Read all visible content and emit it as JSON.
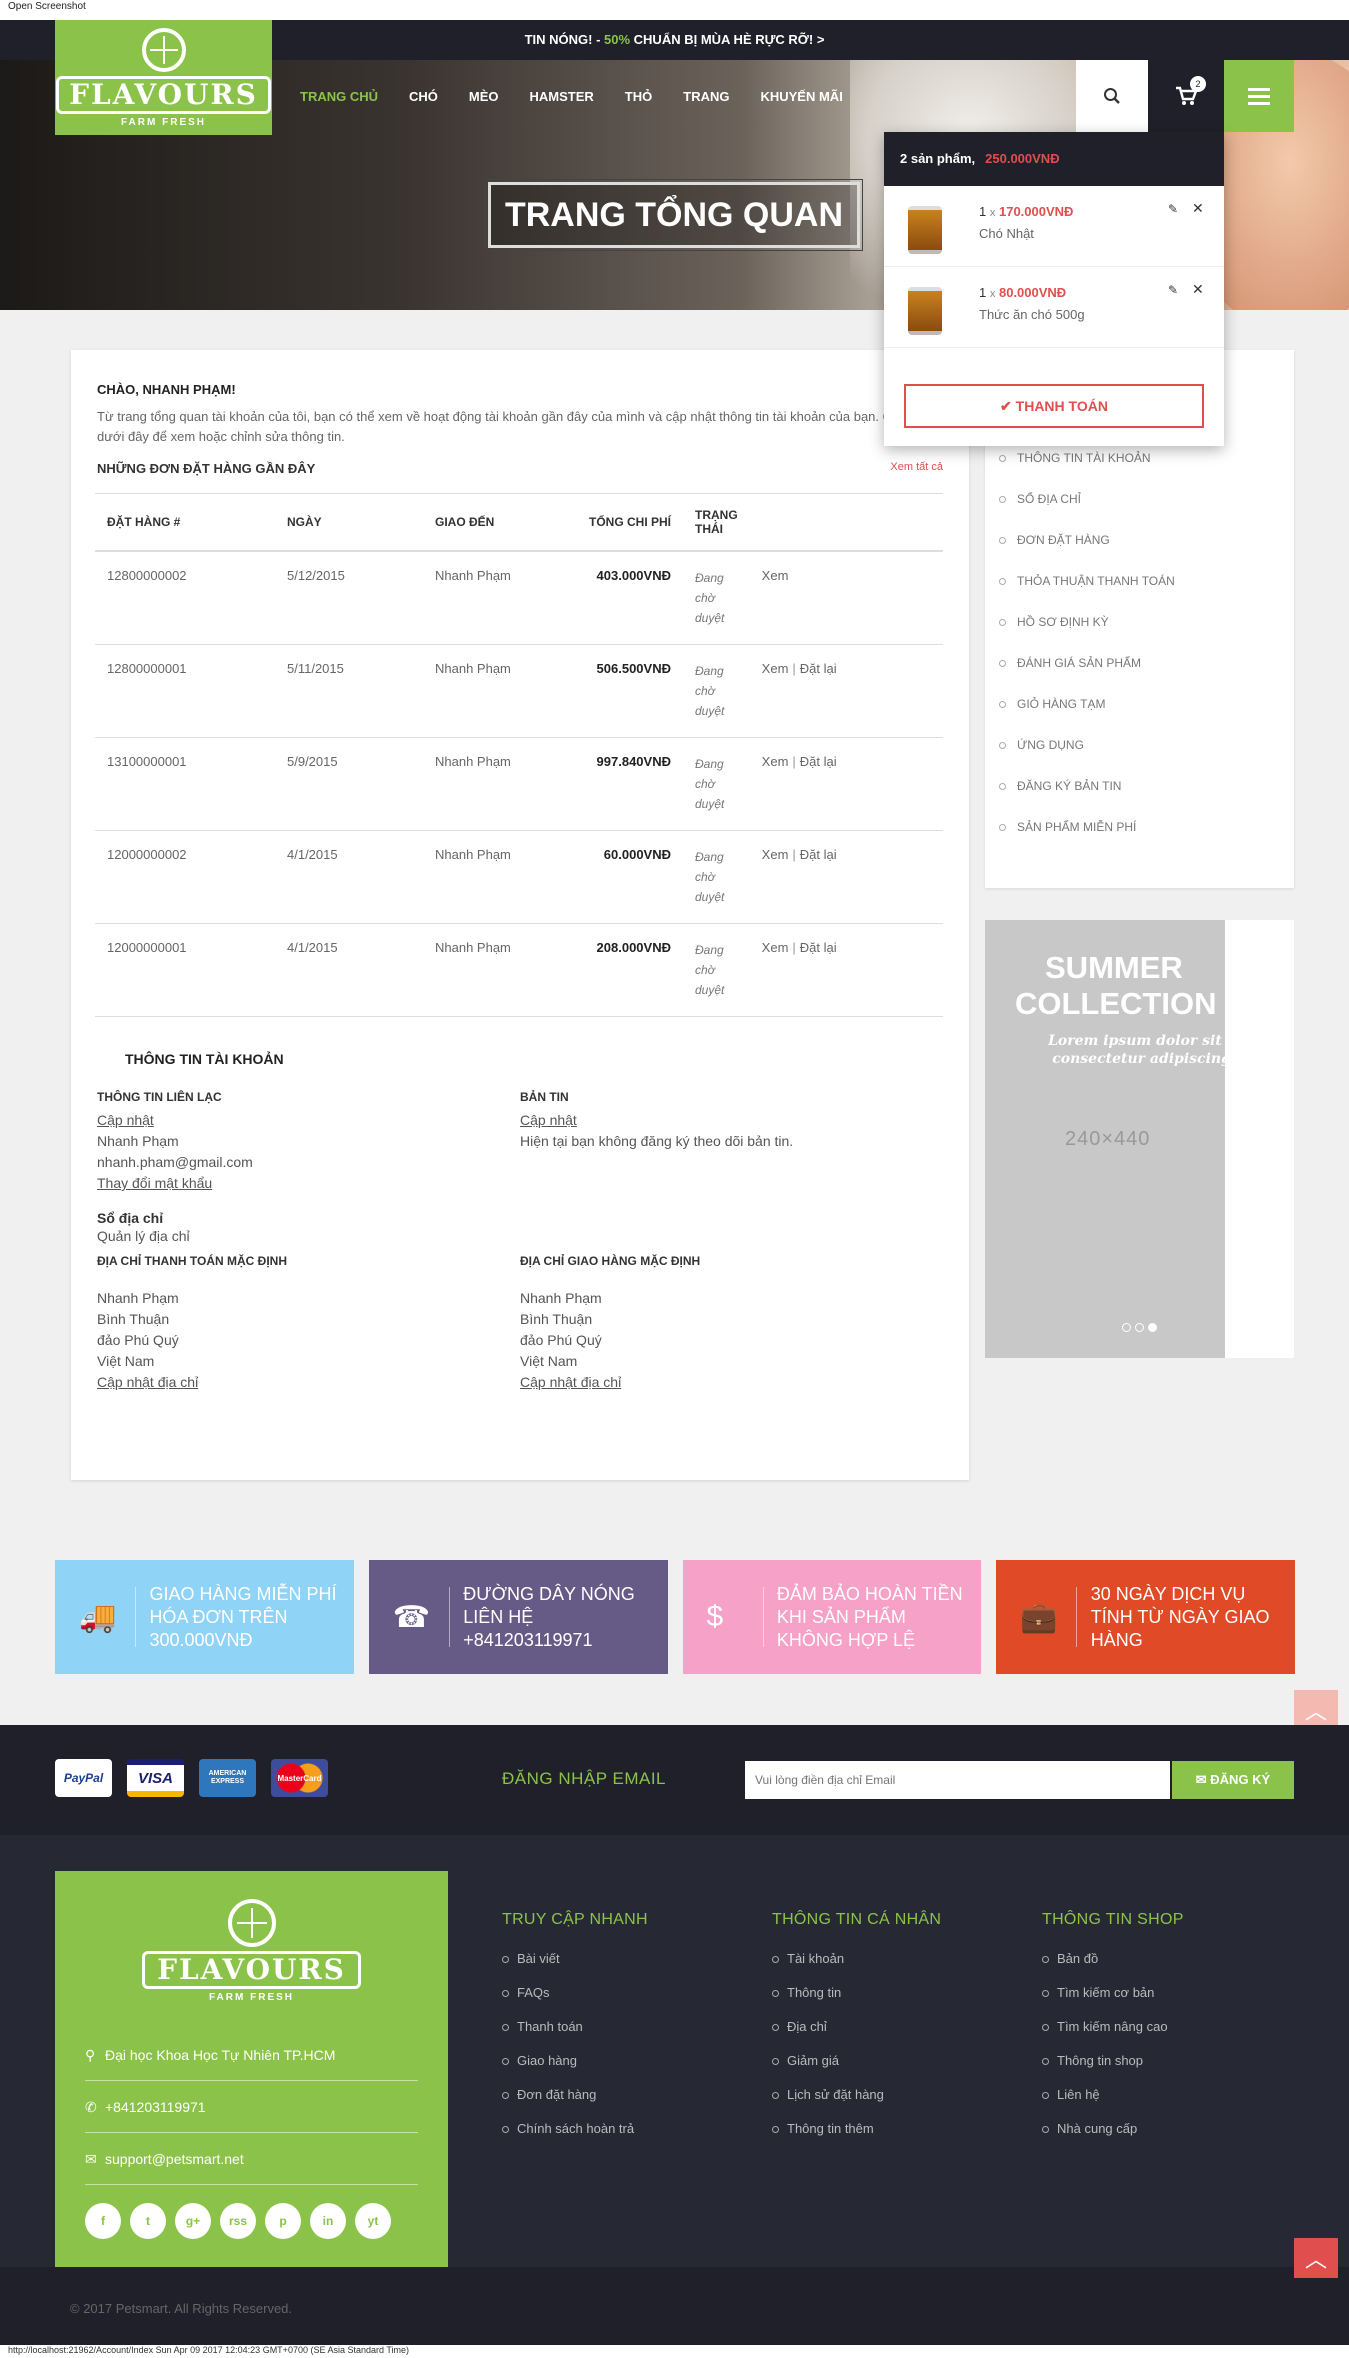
{
  "screenshot": {
    "top_label": "Open Screenshot",
    "status_url": "http://localhost:21962/Account/Index Sun Apr 09 2017 12:04:23 GMT+0700 (SE Asia Standard Time)"
  },
  "topbar": {
    "prefix": "TIN NÓNG! - ",
    "highlight": "50%",
    "suffix": " CHUẨN BỊ MÙA HÈ RỰC RỠ! >"
  },
  "logo": {
    "brand": "FLAVOURS",
    "tagline": "FARM FRESH"
  },
  "nav": {
    "items": [
      "TRANG CHỦ",
      "CHÓ",
      "MÈO",
      "HAMSTER",
      "THỎ",
      "TRANG",
      "KHUYẾN MÃI"
    ],
    "active": 0
  },
  "cart": {
    "count": "2"
  },
  "hero": {
    "title": "TRANG TỔNG QUAN"
  },
  "minicart": {
    "summary": "2 sản phẩm,",
    "total": "250.000VNĐ",
    "items": [
      {
        "qty": "1",
        "price": "170.000VNĐ",
        "name": "Chó Nhật"
      },
      {
        "qty": "1",
        "price": "80.000VNĐ",
        "name": "Thức ăn chó 500g"
      }
    ],
    "checkout": "THANH TOÁN"
  },
  "dashboard": {
    "hello": "CHÀO, NHANH PHẠM!",
    "intro": "Từ trang tổng quan tài khoản của tôi, bạn có thể xem về hoạt động tài khoản gần đây của mình và cập nhật thông tin tài khoản của bạn. Chọn liên kết dưới đây để xem hoặc chỉnh sửa thông tin.",
    "recent_orders": "NHỮNG ĐƠN ĐẶT HÀNG GẦN ĐÂY",
    "view_all": "Xem tất cả",
    "columns": [
      "ĐẶT HÀNG #",
      "NGÀY",
      "GIAO ĐẾN",
      "TỔNG CHI PHÍ",
      "TRẠNG THÁI"
    ],
    "orders": [
      {
        "id": "12800000002",
        "date": "5/12/2015",
        "ship": "Nhanh Phạm",
        "total": "403.000VNĐ",
        "status": "Đang chờ duyệt",
        "view": "Xem",
        "reorder": ""
      },
      {
        "id": "12800000001",
        "date": "5/11/2015",
        "ship": "Nhanh Phạm",
        "total": "506.500VNĐ",
        "status": "Đang chờ duyệt",
        "view": "Xem",
        "reorder": "Đặt lại"
      },
      {
        "id": "13100000001",
        "date": "5/9/2015",
        "ship": "Nhanh Phạm",
        "total": "997.840VNĐ",
        "status": "Đang chờ duyệt",
        "view": "Xem",
        "reorder": "Đặt lại"
      },
      {
        "id": "12000000002",
        "date": "4/1/2015",
        "ship": "Nhanh Phạm",
        "total": "60.000VNĐ",
        "status": "Đang chờ duyệt",
        "view": "Xem",
        "reorder": "Đặt lại"
      },
      {
        "id": "12000000001",
        "date": "4/1/2015",
        "ship": "Nhanh Phạm",
        "total": "208.000VNĐ",
        "status": "Đang chờ duyệt",
        "view": "Xem",
        "reorder": "Đặt lại"
      }
    ],
    "account_title": "THÔNG TIN TÀI KHOẢN",
    "contact": {
      "title": "THÔNG TIN LIÊN LẠC",
      "update": "Cập nhật",
      "name": "Nhanh Phạm",
      "email": "nhanh.pham@gmail.com",
      "change_pw": "Thay đổi mật khẩu"
    },
    "newsletter": {
      "title": "BẢN TIN",
      "update": "Cập nhật",
      "text": "Hiện tại bạn không đăng ký theo dõi bản tin."
    },
    "address": {
      "title": "Sổ địa chỉ",
      "manage": "Quản lý địa chỉ"
    },
    "billing": {
      "title": "ĐỊA CHỈ THANH TOÁN MẶC ĐỊNH",
      "name": "Nhanh Phạm",
      "l1": "Bình Thuận",
      "l2": "đảo Phú Quý",
      "country": "Việt Nam",
      "edit": "Cập nhật địa chỉ"
    },
    "shipping": {
      "title": "ĐỊA CHỈ GIAO HÀNG MẶC ĐỊNH",
      "name": "Nhanh Phạm",
      "l1": "Bình Thuận",
      "l2": "đảo Phú Quý",
      "country": "Việt Nam",
      "edit": "Cập nhật địa chỉ"
    }
  },
  "sidebar": {
    "items": [
      "THÔNG TIN TÀI KHOẢN",
      "SỔ ĐỊA CHỈ",
      "ĐƠN ĐẶT HÀNG",
      "THỎA THUẬN THANH TOÁN",
      "HỒ SƠ ĐỊNH KỲ",
      "ĐÁNH GIÁ SẢN PHẨM",
      "GIỎ HÀNG TẠM",
      "ỨNG DỤNG",
      "ĐĂNG KÝ BẢN TIN",
      "SẢN PHẨM MIỄN PHÍ"
    ]
  },
  "banner": {
    "title1": "SUMMER",
    "title2": "COLLECTION",
    "lorem1": "Lorem ipsum dolor sit amet",
    "lorem2": "consectetur adipiscing elit",
    "size": "240×440"
  },
  "features": [
    {
      "icon": "truck-icon",
      "glyph": "🚚",
      "text": "GIAO HÀNG MIỄN PHÍ HÓA ĐƠN TRÊN 300.000VNĐ",
      "color": "#8fd3f7"
    },
    {
      "icon": "phone-icon",
      "glyph": "☎",
      "text": "ĐƯỜNG DÂY NÓNG LIÊN HỆ +841203119971",
      "color": "#655b86"
    },
    {
      "icon": "dollar-icon",
      "glyph": "$",
      "text": "ĐẢM BẢO HOÀN TIỀN KHI SẢN PHẨM KHÔNG HỢP LỆ",
      "color": "#f6a1c7"
    },
    {
      "icon": "briefcase-icon",
      "glyph": "💼",
      "text": "30 NGÀY DỊCH VỤ TÍNH TỪ NGÀY GIAO HÀNG",
      "color": "#e14a26"
    }
  ],
  "payments": [
    "PayPal",
    "VISA",
    "AMERICAN EXPRESS",
    "MasterCard"
  ],
  "newsletter_bar": {
    "label": "ĐĂNG NHẬP EMAIL",
    "placeholder": "Vui lòng điền địa chỉ Email",
    "button": "ĐĂNG KÝ"
  },
  "footer": {
    "address": "Đại học Khoa Học Tự Nhiên TP.HCM",
    "phone": "+841203119971",
    "email": "support@petsmart.net",
    "socials": [
      "f",
      "t",
      "g+",
      "rss",
      "p",
      "in",
      "yt"
    ],
    "col1": {
      "title": "TRUY CẬP NHANH",
      "items": [
        "Bài viết",
        "FAQs",
        "Thanh toán",
        "Giao hàng",
        "Đơn đặt hàng",
        "Chính sách hoàn trả"
      ]
    },
    "col2": {
      "title": "THÔNG TIN CÁ NHÂN",
      "items": [
        "Tài khoản",
        "Thông tin",
        "Địa chỉ",
        "Giảm giá",
        "Lịch sử đặt hàng",
        "Thông tin thêm"
      ]
    },
    "col3": {
      "title": "THÔNG TIN SHOP",
      "items": [
        "Bản đồ",
        "Tìm kiếm cơ bản",
        "Tìm kiếm nâng cao",
        "Thông tin shop",
        "Liên hệ",
        "Nhà cung cấp"
      ]
    },
    "copyright": "© 2017 Petsmart. All Rights Reserved."
  }
}
